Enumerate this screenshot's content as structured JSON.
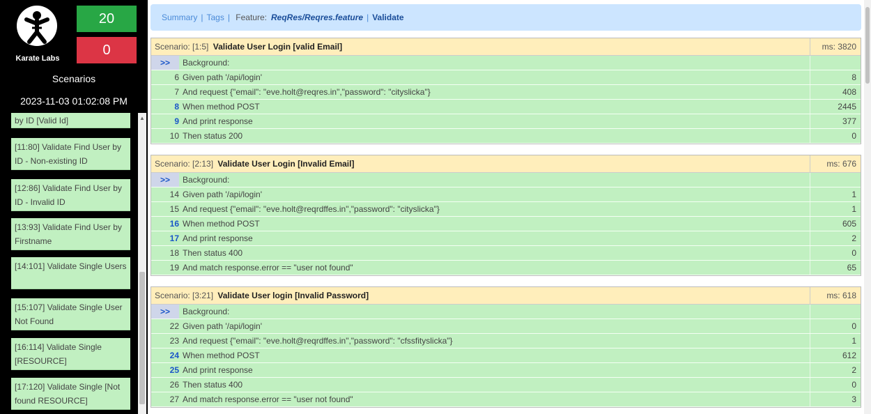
{
  "sidebar": {
    "brand": "Karate Labs",
    "pass_count": "20",
    "fail_count": "0",
    "heading": "Scenarios",
    "timestamp": "2023-11-03 01:02:08 PM",
    "items": [
      {
        "label": "by ID [Valid Id]"
      },
      {
        "label": "[11:80] Validate Find User by ID - Non-existing ID"
      },
      {
        "label": "[12:86] Validate Find User by ID - Invalid ID"
      },
      {
        "label": "[13:93] Validate Find User by Firstname"
      },
      {
        "label": "[14:101] Validate Single Users"
      },
      {
        "label": "[15:107] Validate Single User Not Found"
      },
      {
        "label": "[16:114] Validate Single [RESOURCE]"
      },
      {
        "label": "[17:120] Validate Single [Not found RESOURCE]"
      }
    ]
  },
  "breadcrumb": {
    "summary": "Summary",
    "tags": "Tags",
    "feature_label": "Feature:",
    "feature_name": "ReqRes/Reqres.feature",
    "current": "Validate",
    "sep": "|"
  },
  "scenarios": [
    {
      "prefix": "Scenario: [1:5]",
      "name": "Validate User Login [valid Email]",
      "ms": "ms: 3820",
      "background": ">>",
      "background_label": "Background:",
      "steps": [
        {
          "line": "6",
          "text": "Given path '/api/login'",
          "value": "8",
          "bold": false
        },
        {
          "line": "7",
          "text": "And request {\"email\": \"eve.holt@reqres.in\",\"password\": \"cityslicka\"}",
          "value": "408",
          "bold": false
        },
        {
          "line": "8",
          "text": "When method POST",
          "value": "2445",
          "bold": true
        },
        {
          "line": "9",
          "text": "And print response",
          "value": "377",
          "bold": true
        },
        {
          "line": "10",
          "text": "Then status 200",
          "value": "0",
          "bold": false
        }
      ]
    },
    {
      "prefix": "Scenario: [2:13]",
      "name": "Validate User Login [Invalid Email]",
      "ms": "ms: 676",
      "background": ">>",
      "background_label": "Background:",
      "steps": [
        {
          "line": "14",
          "text": "Given path '/api/login'",
          "value": "1",
          "bold": false
        },
        {
          "line": "15",
          "text": "And request {\"email\": \"eve.holt@reqrdffes.in\",\"password\": \"cityslicka\"}",
          "value": "1",
          "bold": false
        },
        {
          "line": "16",
          "text": "When method POST",
          "value": "605",
          "bold": true
        },
        {
          "line": "17",
          "text": "And print response",
          "value": "2",
          "bold": true
        },
        {
          "line": "18",
          "text": "Then status 400",
          "value": "0",
          "bold": false
        },
        {
          "line": "19",
          "text": "And match response.error == \"user not found\"",
          "value": "65",
          "bold": false
        }
      ]
    },
    {
      "prefix": "Scenario: [3:21]",
      "name": "Validate User login [Invalid Password]",
      "ms": "ms: 618",
      "background": ">>",
      "background_label": "Background:",
      "steps": [
        {
          "line": "22",
          "text": "Given path '/api/login'",
          "value": "0",
          "bold": false
        },
        {
          "line": "23",
          "text": "And request {\"email\": \"eve.holt@reqrdffes.in\",\"password\": \"cfssfityslicka\"}",
          "value": "1",
          "bold": false
        },
        {
          "line": "24",
          "text": "When method POST",
          "value": "612",
          "bold": true
        },
        {
          "line": "25",
          "text": "And print response",
          "value": "2",
          "bold": true
        },
        {
          "line": "26",
          "text": "Then status 400",
          "value": "0",
          "bold": false
        },
        {
          "line": "27",
          "text": "And match response.error == \"user not found\"",
          "value": "3",
          "bold": false
        }
      ]
    }
  ]
}
